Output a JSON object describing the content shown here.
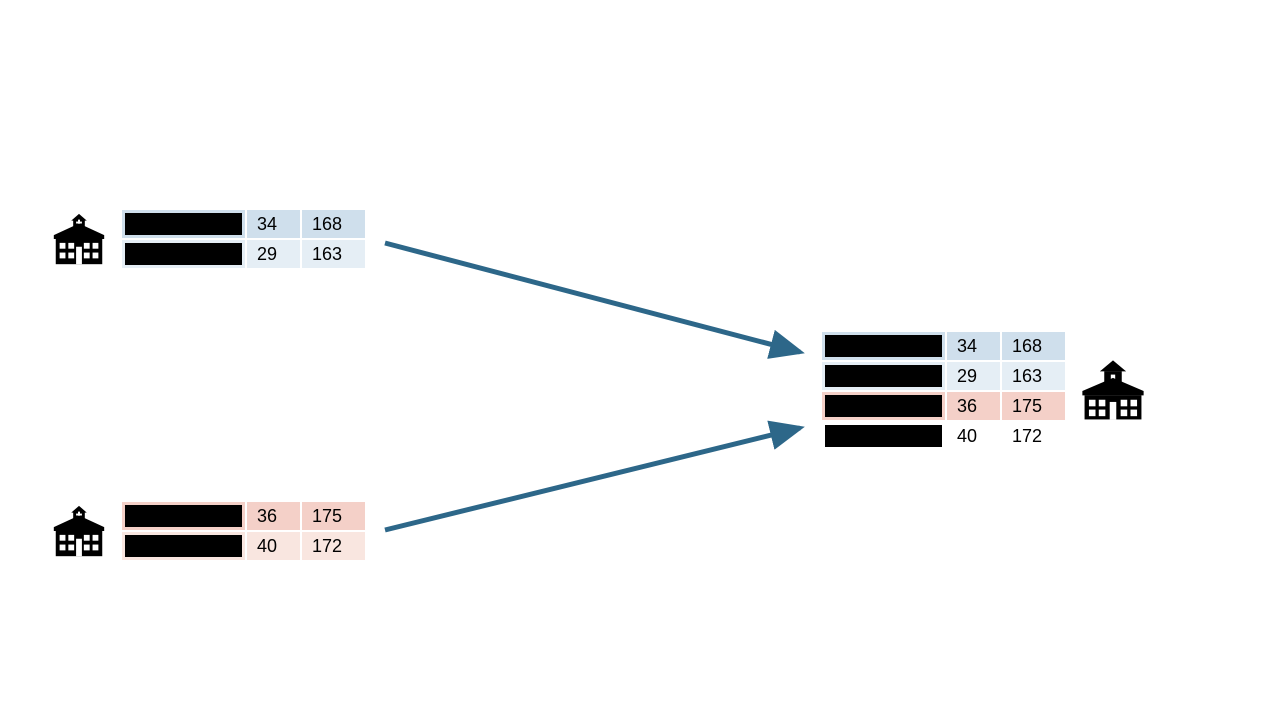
{
  "colors": {
    "arrow": "#2d6789",
    "blue_dark": "#cfdfec",
    "blue_light": "#e5eef5",
    "pink_dark": "#f4d0c8",
    "pink_light": "#f9e6e0"
  },
  "source_a": {
    "rows": [
      {
        "v1": "34",
        "v2": "168"
      },
      {
        "v1": "29",
        "v2": "163"
      }
    ]
  },
  "source_b": {
    "rows": [
      {
        "v1": "36",
        "v2": "175"
      },
      {
        "v1": "40",
        "v2": "172"
      }
    ]
  },
  "target": {
    "rows": [
      {
        "v1": "34",
        "v2": "168"
      },
      {
        "v1": "29",
        "v2": "163"
      },
      {
        "v1": "36",
        "v2": "175"
      },
      {
        "v1": "40",
        "v2": "172"
      }
    ]
  }
}
